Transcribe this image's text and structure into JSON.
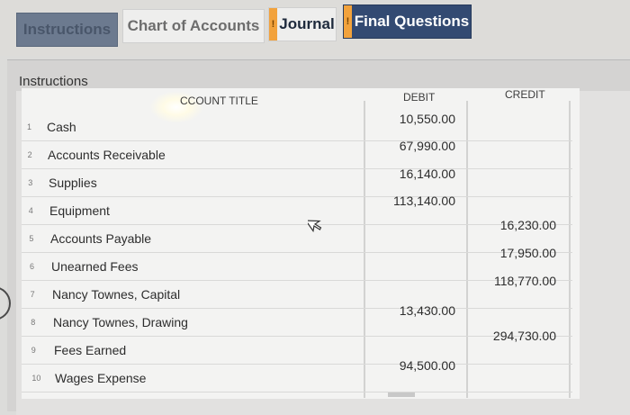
{
  "tabs": {
    "instructions": "Instructions",
    "chart_of_accounts": "Chart of Accounts",
    "journal": "Journal",
    "final_questions": "Final Questions",
    "warning_mark": "!"
  },
  "panel": {
    "title": "Instructions"
  },
  "table": {
    "headers": {
      "account_title": "CCOUNT TITLE",
      "debit": "DEBIT",
      "credit": "CREDIT"
    },
    "rows": [
      {
        "num": "1",
        "account": "Cash",
        "debit": "10,550.00",
        "credit": ""
      },
      {
        "num": "2",
        "account": "Accounts Receivable",
        "debit": "67,990.00",
        "credit": ""
      },
      {
        "num": "3",
        "account": "Supplies",
        "debit": "16,140.00",
        "credit": ""
      },
      {
        "num": "4",
        "account": "Equipment",
        "debit": "113,140.00",
        "credit": ""
      },
      {
        "num": "5",
        "account": "Accounts Payable",
        "debit": "",
        "credit": "16,230.00"
      },
      {
        "num": "6",
        "account": "Unearned Fees",
        "debit": "",
        "credit": "17,950.00"
      },
      {
        "num": "7",
        "account": "Nancy Townes, Capital",
        "debit": "",
        "credit": "118,770.00"
      },
      {
        "num": "8",
        "account": "Nancy Townes, Drawing",
        "debit": "13,430.00",
        "credit": ""
      },
      {
        "num": "9",
        "account": "Fees Earned",
        "debit": "",
        "credit": "294,730.00"
      },
      {
        "num": "10",
        "account": "Wages Expense",
        "debit": "94,500.00",
        "credit": ""
      }
    ]
  },
  "colors": {
    "active_tab": "#334a72",
    "warning": "#f2a23c"
  }
}
